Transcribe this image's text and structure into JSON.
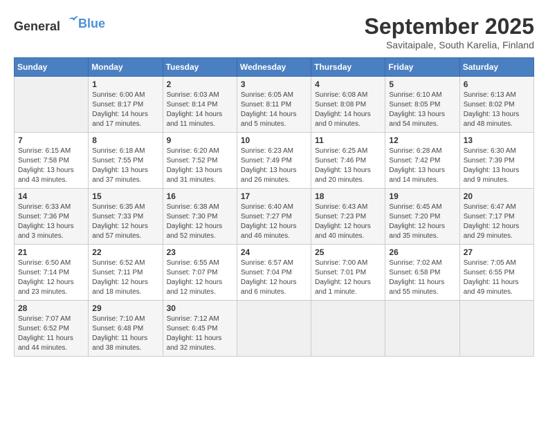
{
  "header": {
    "logo_general": "General",
    "logo_blue": "Blue",
    "title": "September 2025",
    "subtitle": "Savitaipale, South Karelia, Finland"
  },
  "calendar": {
    "days_of_week": [
      "Sunday",
      "Monday",
      "Tuesday",
      "Wednesday",
      "Thursday",
      "Friday",
      "Saturday"
    ],
    "weeks": [
      [
        {
          "day": "",
          "info": ""
        },
        {
          "day": "1",
          "info": "Sunrise: 6:00 AM\nSunset: 8:17 PM\nDaylight: 14 hours\nand 17 minutes."
        },
        {
          "day": "2",
          "info": "Sunrise: 6:03 AM\nSunset: 8:14 PM\nDaylight: 14 hours\nand 11 minutes."
        },
        {
          "day": "3",
          "info": "Sunrise: 6:05 AM\nSunset: 8:11 PM\nDaylight: 14 hours\nand 5 minutes."
        },
        {
          "day": "4",
          "info": "Sunrise: 6:08 AM\nSunset: 8:08 PM\nDaylight: 14 hours\nand 0 minutes."
        },
        {
          "day": "5",
          "info": "Sunrise: 6:10 AM\nSunset: 8:05 PM\nDaylight: 13 hours\nand 54 minutes."
        },
        {
          "day": "6",
          "info": "Sunrise: 6:13 AM\nSunset: 8:02 PM\nDaylight: 13 hours\nand 48 minutes."
        }
      ],
      [
        {
          "day": "7",
          "info": "Sunrise: 6:15 AM\nSunset: 7:58 PM\nDaylight: 13 hours\nand 43 minutes."
        },
        {
          "day": "8",
          "info": "Sunrise: 6:18 AM\nSunset: 7:55 PM\nDaylight: 13 hours\nand 37 minutes."
        },
        {
          "day": "9",
          "info": "Sunrise: 6:20 AM\nSunset: 7:52 PM\nDaylight: 13 hours\nand 31 minutes."
        },
        {
          "day": "10",
          "info": "Sunrise: 6:23 AM\nSunset: 7:49 PM\nDaylight: 13 hours\nand 26 minutes."
        },
        {
          "day": "11",
          "info": "Sunrise: 6:25 AM\nSunset: 7:46 PM\nDaylight: 13 hours\nand 20 minutes."
        },
        {
          "day": "12",
          "info": "Sunrise: 6:28 AM\nSunset: 7:42 PM\nDaylight: 13 hours\nand 14 minutes."
        },
        {
          "day": "13",
          "info": "Sunrise: 6:30 AM\nSunset: 7:39 PM\nDaylight: 13 hours\nand 9 minutes."
        }
      ],
      [
        {
          "day": "14",
          "info": "Sunrise: 6:33 AM\nSunset: 7:36 PM\nDaylight: 13 hours\nand 3 minutes."
        },
        {
          "day": "15",
          "info": "Sunrise: 6:35 AM\nSunset: 7:33 PM\nDaylight: 12 hours\nand 57 minutes."
        },
        {
          "day": "16",
          "info": "Sunrise: 6:38 AM\nSunset: 7:30 PM\nDaylight: 12 hours\nand 52 minutes."
        },
        {
          "day": "17",
          "info": "Sunrise: 6:40 AM\nSunset: 7:27 PM\nDaylight: 12 hours\nand 46 minutes."
        },
        {
          "day": "18",
          "info": "Sunrise: 6:43 AM\nSunset: 7:23 PM\nDaylight: 12 hours\nand 40 minutes."
        },
        {
          "day": "19",
          "info": "Sunrise: 6:45 AM\nSunset: 7:20 PM\nDaylight: 12 hours\nand 35 minutes."
        },
        {
          "day": "20",
          "info": "Sunrise: 6:47 AM\nSunset: 7:17 PM\nDaylight: 12 hours\nand 29 minutes."
        }
      ],
      [
        {
          "day": "21",
          "info": "Sunrise: 6:50 AM\nSunset: 7:14 PM\nDaylight: 12 hours\nand 23 minutes."
        },
        {
          "day": "22",
          "info": "Sunrise: 6:52 AM\nSunset: 7:11 PM\nDaylight: 12 hours\nand 18 minutes."
        },
        {
          "day": "23",
          "info": "Sunrise: 6:55 AM\nSunset: 7:07 PM\nDaylight: 12 hours\nand 12 minutes."
        },
        {
          "day": "24",
          "info": "Sunrise: 6:57 AM\nSunset: 7:04 PM\nDaylight: 12 hours\nand 6 minutes."
        },
        {
          "day": "25",
          "info": "Sunrise: 7:00 AM\nSunset: 7:01 PM\nDaylight: 12 hours\nand 1 minute."
        },
        {
          "day": "26",
          "info": "Sunrise: 7:02 AM\nSunset: 6:58 PM\nDaylight: 11 hours\nand 55 minutes."
        },
        {
          "day": "27",
          "info": "Sunrise: 7:05 AM\nSunset: 6:55 PM\nDaylight: 11 hours\nand 49 minutes."
        }
      ],
      [
        {
          "day": "28",
          "info": "Sunrise: 7:07 AM\nSunset: 6:52 PM\nDaylight: 11 hours\nand 44 minutes."
        },
        {
          "day": "29",
          "info": "Sunrise: 7:10 AM\nSunset: 6:48 PM\nDaylight: 11 hours\nand 38 minutes."
        },
        {
          "day": "30",
          "info": "Sunrise: 7:12 AM\nSunset: 6:45 PM\nDaylight: 11 hours\nand 32 minutes."
        },
        {
          "day": "",
          "info": ""
        },
        {
          "day": "",
          "info": ""
        },
        {
          "day": "",
          "info": ""
        },
        {
          "day": "",
          "info": ""
        }
      ]
    ]
  }
}
